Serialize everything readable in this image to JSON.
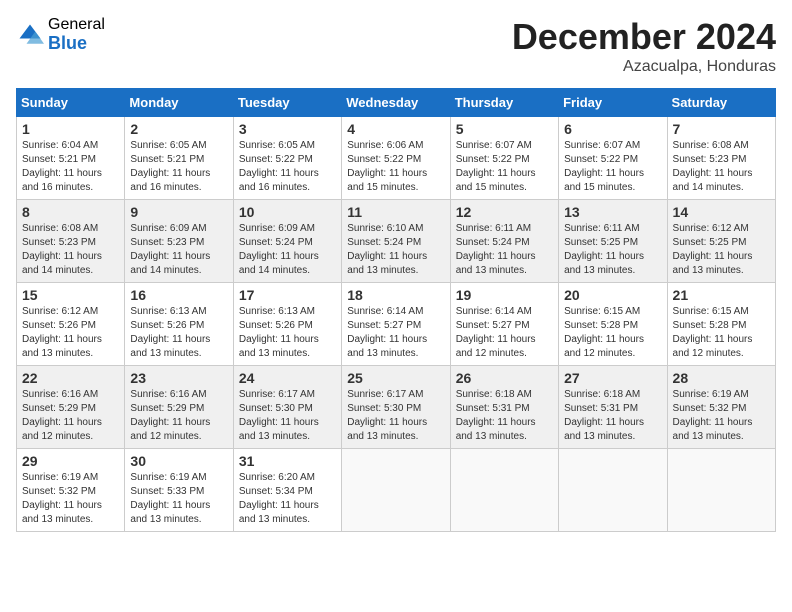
{
  "logo": {
    "general": "General",
    "blue": "Blue"
  },
  "title": {
    "month": "December 2024",
    "location": "Azacualpa, Honduras"
  },
  "headers": [
    "Sunday",
    "Monday",
    "Tuesday",
    "Wednesday",
    "Thursday",
    "Friday",
    "Saturday"
  ],
  "weeks": [
    [
      {
        "day": "1",
        "sunrise": "6:04 AM",
        "sunset": "5:21 PM",
        "daylight": "11 hours and 16 minutes."
      },
      {
        "day": "2",
        "sunrise": "6:05 AM",
        "sunset": "5:21 PM",
        "daylight": "11 hours and 16 minutes."
      },
      {
        "day": "3",
        "sunrise": "6:05 AM",
        "sunset": "5:22 PM",
        "daylight": "11 hours and 16 minutes."
      },
      {
        "day": "4",
        "sunrise": "6:06 AM",
        "sunset": "5:22 PM",
        "daylight": "11 hours and 15 minutes."
      },
      {
        "day": "5",
        "sunrise": "6:07 AM",
        "sunset": "5:22 PM",
        "daylight": "11 hours and 15 minutes."
      },
      {
        "day": "6",
        "sunrise": "6:07 AM",
        "sunset": "5:22 PM",
        "daylight": "11 hours and 15 minutes."
      },
      {
        "day": "7",
        "sunrise": "6:08 AM",
        "sunset": "5:23 PM",
        "daylight": "11 hours and 14 minutes."
      }
    ],
    [
      {
        "day": "8",
        "sunrise": "6:08 AM",
        "sunset": "5:23 PM",
        "daylight": "11 hours and 14 minutes."
      },
      {
        "day": "9",
        "sunrise": "6:09 AM",
        "sunset": "5:23 PM",
        "daylight": "11 hours and 14 minutes."
      },
      {
        "day": "10",
        "sunrise": "6:09 AM",
        "sunset": "5:24 PM",
        "daylight": "11 hours and 14 minutes."
      },
      {
        "day": "11",
        "sunrise": "6:10 AM",
        "sunset": "5:24 PM",
        "daylight": "11 hours and 13 minutes."
      },
      {
        "day": "12",
        "sunrise": "6:11 AM",
        "sunset": "5:24 PM",
        "daylight": "11 hours and 13 minutes."
      },
      {
        "day": "13",
        "sunrise": "6:11 AM",
        "sunset": "5:25 PM",
        "daylight": "11 hours and 13 minutes."
      },
      {
        "day": "14",
        "sunrise": "6:12 AM",
        "sunset": "5:25 PM",
        "daylight": "11 hours and 13 minutes."
      }
    ],
    [
      {
        "day": "15",
        "sunrise": "6:12 AM",
        "sunset": "5:26 PM",
        "daylight": "11 hours and 13 minutes."
      },
      {
        "day": "16",
        "sunrise": "6:13 AM",
        "sunset": "5:26 PM",
        "daylight": "11 hours and 13 minutes."
      },
      {
        "day": "17",
        "sunrise": "6:13 AM",
        "sunset": "5:26 PM",
        "daylight": "11 hours and 13 minutes."
      },
      {
        "day": "18",
        "sunrise": "6:14 AM",
        "sunset": "5:27 PM",
        "daylight": "11 hours and 13 minutes."
      },
      {
        "day": "19",
        "sunrise": "6:14 AM",
        "sunset": "5:27 PM",
        "daylight": "11 hours and 12 minutes."
      },
      {
        "day": "20",
        "sunrise": "6:15 AM",
        "sunset": "5:28 PM",
        "daylight": "11 hours and 12 minutes."
      },
      {
        "day": "21",
        "sunrise": "6:15 AM",
        "sunset": "5:28 PM",
        "daylight": "11 hours and 12 minutes."
      }
    ],
    [
      {
        "day": "22",
        "sunrise": "6:16 AM",
        "sunset": "5:29 PM",
        "daylight": "11 hours and 12 minutes."
      },
      {
        "day": "23",
        "sunrise": "6:16 AM",
        "sunset": "5:29 PM",
        "daylight": "11 hours and 12 minutes."
      },
      {
        "day": "24",
        "sunrise": "6:17 AM",
        "sunset": "5:30 PM",
        "daylight": "11 hours and 13 minutes."
      },
      {
        "day": "25",
        "sunrise": "6:17 AM",
        "sunset": "5:30 PM",
        "daylight": "11 hours and 13 minutes."
      },
      {
        "day": "26",
        "sunrise": "6:18 AM",
        "sunset": "5:31 PM",
        "daylight": "11 hours and 13 minutes."
      },
      {
        "day": "27",
        "sunrise": "6:18 AM",
        "sunset": "5:31 PM",
        "daylight": "11 hours and 13 minutes."
      },
      {
        "day": "28",
        "sunrise": "6:19 AM",
        "sunset": "5:32 PM",
        "daylight": "11 hours and 13 minutes."
      }
    ],
    [
      {
        "day": "29",
        "sunrise": "6:19 AM",
        "sunset": "5:32 PM",
        "daylight": "11 hours and 13 minutes."
      },
      {
        "day": "30",
        "sunrise": "6:19 AM",
        "sunset": "5:33 PM",
        "daylight": "11 hours and 13 minutes."
      },
      {
        "day": "31",
        "sunrise": "6:20 AM",
        "sunset": "5:34 PM",
        "daylight": "11 hours and 13 minutes."
      },
      null,
      null,
      null,
      null
    ]
  ],
  "labels": {
    "sunrise": "Sunrise:",
    "sunset": "Sunset:",
    "daylight": "Daylight:"
  }
}
